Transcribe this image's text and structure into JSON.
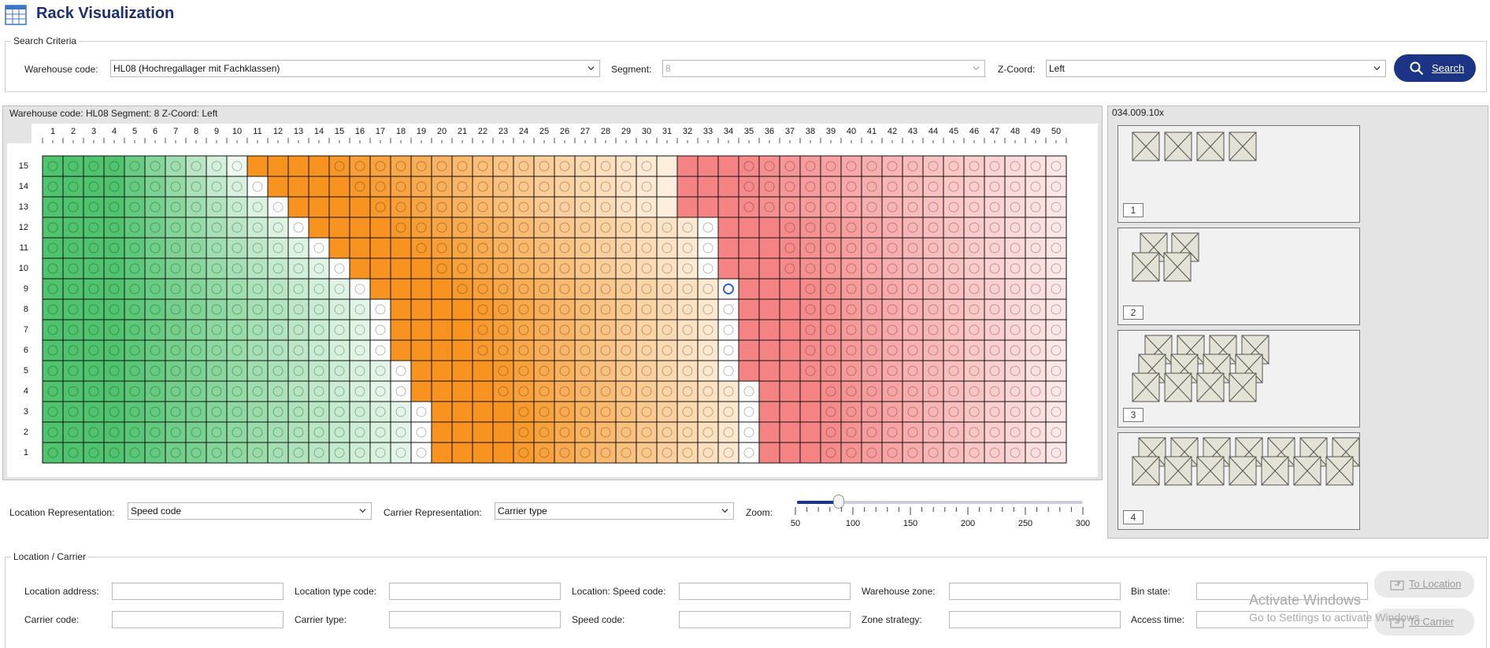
{
  "app": {
    "title": "Rack Visualization"
  },
  "search": {
    "legend": "Search Criteria",
    "warehouse_label": "Warehouse code:",
    "warehouse_value": "HL08 (Hochregallager mit Fachklassen)",
    "segment_label": "Segment:",
    "segment_value": "8",
    "zcoord_label": "Z-Coord:",
    "zcoord_value": "Left",
    "search_button": "Search"
  },
  "rack": {
    "header": "Warehouse code: HL08   Segment: 8   Z-Coord: Left",
    "columns": 50,
    "rows": 15,
    "selected_location": {
      "column": 34,
      "row": 9
    },
    "colors": {
      "green": "#4fc36d",
      "orange": "#f7931e",
      "red": "#f58383",
      "white": "#ffffff",
      "grid_line": "#111111",
      "selected_ring": "#2f66c9"
    }
  },
  "carrier_panel": {
    "header": "034.009.10x",
    "cards": [
      {
        "label": "1",
        "carriers": 4
      },
      {
        "label": "2",
        "carriers": 4
      },
      {
        "label": "3",
        "carriers": 16
      },
      {
        "label": "4",
        "carriers": 14
      }
    ]
  },
  "representation": {
    "location_label": "Location Representation:",
    "location_value": "Speed code",
    "carrier_label": "Carrier Representation:",
    "carrier_value": "Carrier type",
    "zoom_label": "Zoom:",
    "zoom_ticks": [
      "50",
      "100",
      "150",
      "200",
      "250",
      "300"
    ],
    "zoom_value": 88
  },
  "details": {
    "legend": "Location / Carrier",
    "fields": [
      {
        "label": "Location address:",
        "value": ""
      },
      {
        "label": "Location type code:",
        "value": ""
      },
      {
        "label": "Location: Speed code:",
        "value": ""
      },
      {
        "label": "Warehouse zone:",
        "value": ""
      },
      {
        "label": "Bin state:",
        "value": ""
      },
      {
        "label": "Carrier code:",
        "value": ""
      },
      {
        "label": "Carrier type:",
        "value": ""
      },
      {
        "label": "Speed code:",
        "value": ""
      },
      {
        "label": "Zone strategy:",
        "value": ""
      },
      {
        "label": "Access time:",
        "value": ""
      }
    ],
    "to_location_button": "To Location",
    "to_carrier_button": "To Carrier"
  },
  "watermark": {
    "line1": "Activate Windows",
    "line2": "Go to Settings to activate Windows."
  }
}
